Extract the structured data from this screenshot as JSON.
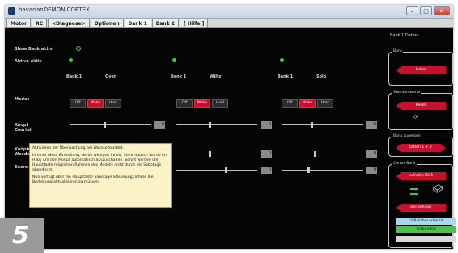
{
  "window": {
    "title": "bavarianDEMON CORTEX",
    "minimize": "–",
    "maximize": "□",
    "close": "✕"
  },
  "tabs": [
    {
      "label": "Motor"
    },
    {
      "label": "RC"
    },
    {
      "label": "<Diagnose>"
    },
    {
      "label": "Optionen"
    },
    {
      "label": "Bank 1"
    },
    {
      "label": "Bank 2"
    },
    {
      "label": "[ Hilfe ]"
    }
  ],
  "active_tab": "Bank 1",
  "banks": {
    "show_bank_label": "Show Bank aktiv",
    "active_label": "Aktive aktiv",
    "modes_label": "Modes",
    "mode_options": [
      "Off",
      "Wake",
      "Hold"
    ],
    "rows": [
      {
        "label": "Knopf Courtall"
      },
      {
        "label": "Knöpfel Wesdag"
      },
      {
        "label": "Enercis"
      }
    ],
    "columns": [
      {
        "bank": "Bank 1",
        "name": "Over",
        "mode": "Wake",
        "values": [
          "0",
          "0",
          "0"
        ]
      },
      {
        "bank": "Bank 1",
        "name": "Wiltz",
        "mode": "Wake",
        "values": [
          "0",
          "0",
          "0"
        ]
      },
      {
        "bank": "Bank 1",
        "name": "Solo",
        "mode": "Wake",
        "values": [
          "0",
          "0",
          "0"
        ]
      }
    ]
  },
  "sidebar": {
    "header": "Bank 1 Daten",
    "panels": [
      {
        "title": "Bank",
        "button": "laden"
      },
      {
        "title": "Standardwerte",
        "button": "Reset",
        "icon": "refresh-icon"
      },
      {
        "title": "Bank zuweisen",
        "button": "Daten 1 + 2"
      },
      {
        "title": "Cortex Bank",
        "button_top": "aufrufen Bk 1",
        "button_bottom": "alle senden"
      }
    ],
    "status_bars": [
      {
        "label": "USB-Kabel erkannt",
        "color": "#a9d8ee"
      },
      {
        "label": "Verbunden",
        "color": "#4cc24c"
      },
      {
        "label": "",
        "color": "#d9d9d9"
      }
    ]
  },
  "tooltip": {
    "paragraphs": [
      "Aktivieren der Überwachung bei Wassserkontakt.",
      "In hiner diese Einstellung, deren wenigen Inhalt, Stimmtausch wurde im Hiiby um den Modus automatisch auszuschalten. Sofort werden die Haupttaste möglichen Rahmen des Modells nicht durch die Sabotage abgedeckt.",
      "Nun verfügt über die Haupttaste Sabotage Steuerung; offene die Bedienung aktualisieren zu müssen."
    ]
  },
  "figure_badge": "5",
  "colors": {
    "accent": "#c8102e",
    "led": "#3fcf3f",
    "background": "#050505"
  }
}
